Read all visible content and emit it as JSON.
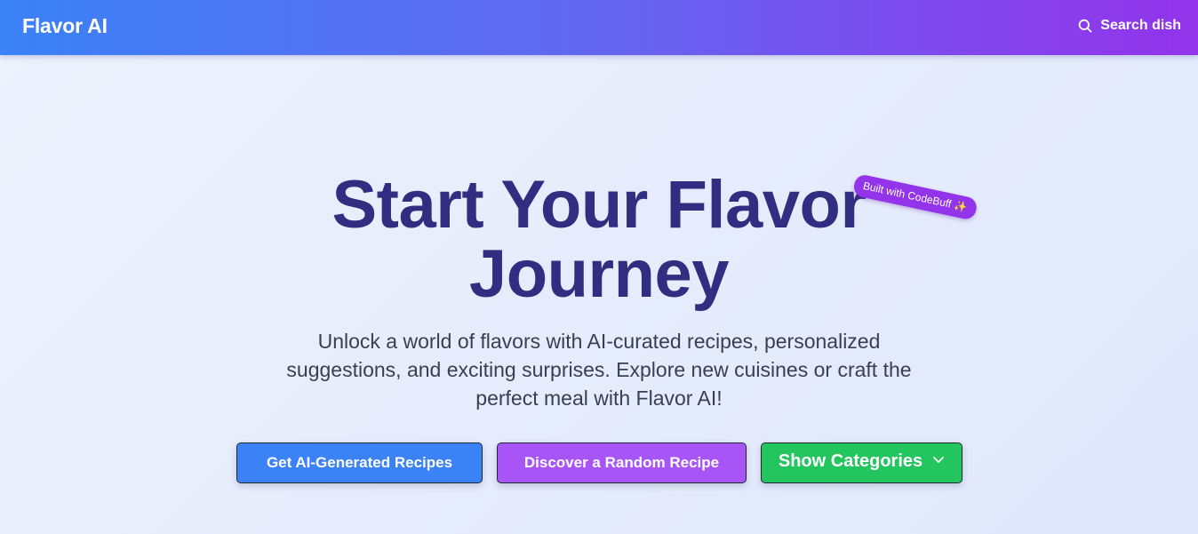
{
  "navbar": {
    "brand": "Flavor AI",
    "search_label": "Search dish",
    "search_icon": "search-icon"
  },
  "hero": {
    "badge": "Built with CodeBuff ✨",
    "title_line1": "Start Your Flavor",
    "title_line2": "Journey",
    "subtitle": "Unlock a world of flavors with AI-curated recipes, personalized suggestions, and exciting surprises. Explore new cuisines or craft the perfect meal with Flavor AI!"
  },
  "buttons": {
    "ai_recipes": "Get AI-Generated Recipes",
    "random_recipe": "Discover a Random Recipe",
    "show_categories": "Show Categories",
    "categories_icon": "chevron-down-icon"
  },
  "colors": {
    "nav_gradient_start": "#3b82f6",
    "nav_gradient_end": "#9333ea",
    "title": "#312e81",
    "btn_blue": "#3b82f6",
    "btn_purple": "#a855f7",
    "btn_green": "#22c55e",
    "badge": "#9333ea"
  }
}
